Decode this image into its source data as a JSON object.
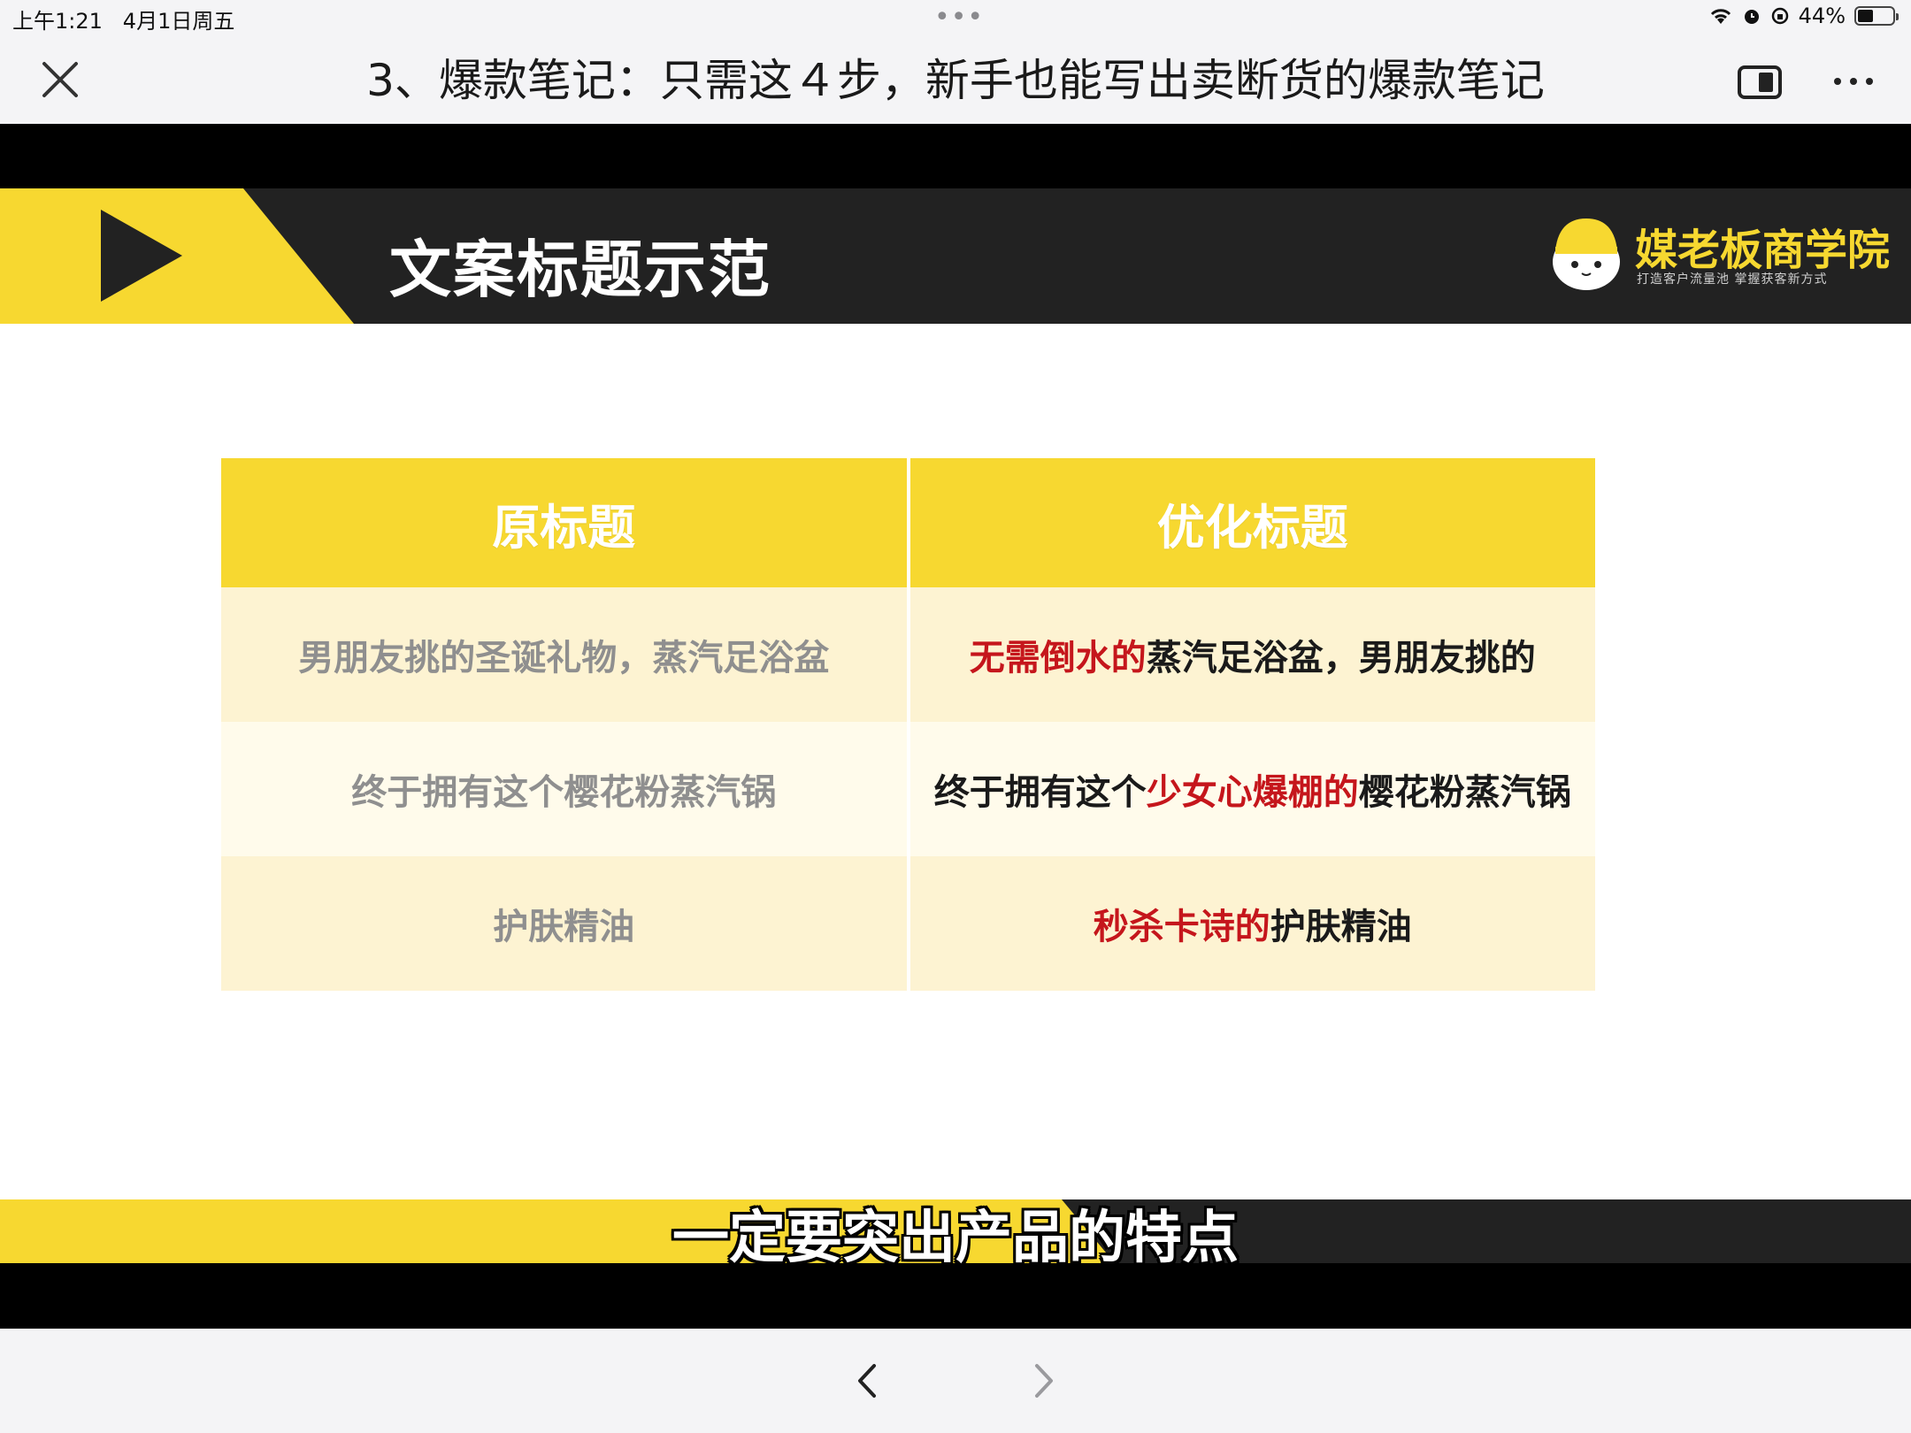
{
  "status": {
    "time": "上午1:21",
    "date": "4月1日周五",
    "dots": "•••",
    "battery_percent": "44%",
    "battery_level": 0.44,
    "icons": [
      "wifi-icon",
      "alarm-icon",
      "orientation-lock-icon",
      "battery-icon"
    ]
  },
  "nav": {
    "title": "3、爆款笔记：只需这４步，新手也能写出卖断货的爆款笔记",
    "close_icon": "close-icon",
    "window_icon": "floating-window-icon",
    "more_icon": "more-icon"
  },
  "slide": {
    "heading": "文案标题示范",
    "brand_name": "媒老板商学院",
    "brand_tagline": "打造客户流量池    掌握获客新方式",
    "table": {
      "headers": [
        "原标题",
        "优化标题"
      ],
      "rows": [
        {
          "original": "男朋友挑的圣诞礼物，蒸汽足浴盆",
          "optimized_parts": [
            "无需倒水的",
            "蒸汽足浴盆，男朋友挑的"
          ]
        },
        {
          "original": "终于拥有这个樱花粉蒸汽锅",
          "optimized_parts": [
            "终于拥有这个",
            "少女心爆棚的",
            "樱花粉蒸汽锅"
          ]
        },
        {
          "original": "护肤精油",
          "optimized_parts": [
            "秒杀卡诗的",
            "护肤精油"
          ]
        }
      ]
    }
  },
  "subtitle": "一定要突出产品的特点",
  "colors": {
    "accent_yellow": "#f7d830",
    "header_dark": "#222222",
    "highlight_red": "#c5161c"
  },
  "bottom": {
    "back_icon": "chevron-left-icon",
    "forward_icon": "chevron-right-icon"
  }
}
